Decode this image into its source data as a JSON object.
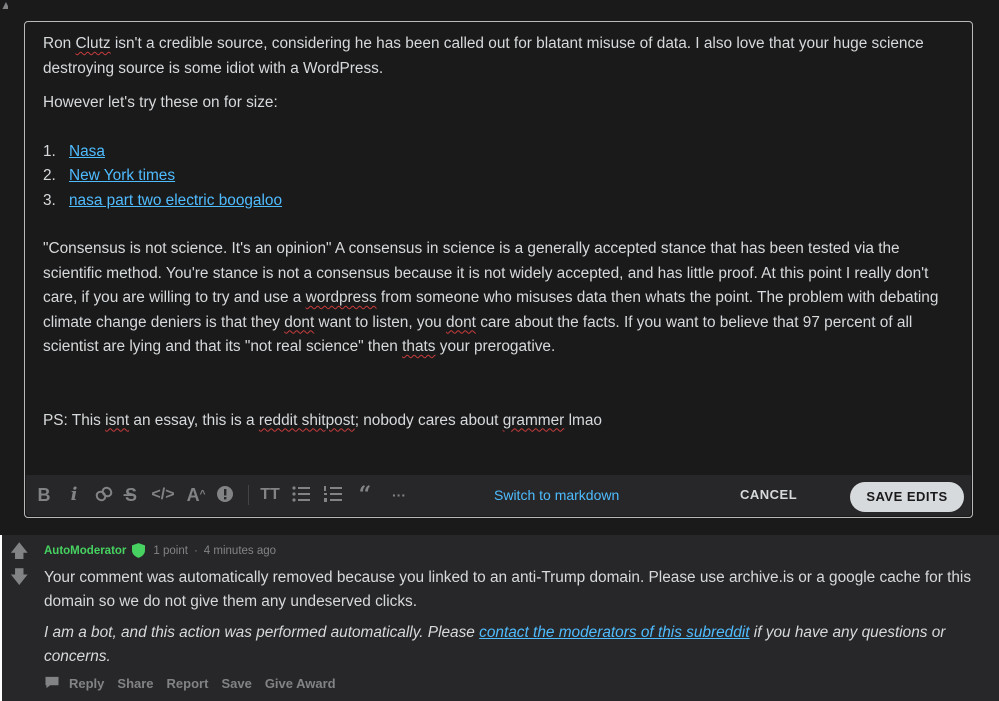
{
  "editor": {
    "paragraph1": {
      "part1": "Ron ",
      "sq1": "Clutz",
      "part2": " isn't a credible source, considering he has been called out for blatant misuse of data. I also love that your huge science destroying source is some idiot with a WordPress."
    },
    "paragraph2": "However let's try these on for size:",
    "links": [
      {
        "num": "1.",
        "label": "Nasa"
      },
      {
        "num": "2.",
        "label": "New York times"
      },
      {
        "num": "3.",
        "label": "nasa part two electric boogaloo"
      }
    ],
    "paragraph3": {
      "a": "\"Consensus is not science. It's an opinion\" A consensus in science is a generally accepted stance that has been tested via the scientific method. You're stance is not a consensus because it is not widely accepted, and has little proof. At this point I really don't care, if you are willing to try and use a ",
      "sq_wordpress": "wordpress",
      "b": " from someone who misuses data then whats the point. The problem with debating climate change deniers is that they ",
      "sq_dont1": "dont",
      "c": " want to listen, you ",
      "sq_dont2": "dont",
      "d": " care about the facts. If you want to believe that 97 percent of all scientist are lying and that its \"not real science\" then ",
      "sq_thats": "thats",
      "e": " your prerogative."
    },
    "paragraph4": {
      "a": "PS: This ",
      "sq_isnt": "isnt",
      "b": " an essay, this is a ",
      "sq_reddit": "reddit shitpost",
      "c": "; nobody cares about ",
      "sq_grammer": "grammer",
      "d": " lmao"
    }
  },
  "toolbar": {
    "icons": [
      "bold-icon",
      "italic-icon",
      "link-icon",
      "strikethrough-icon",
      "inline-code-icon",
      "superscript-icon",
      "spoiler-icon",
      "heading-icon",
      "bulleted-list-icon",
      "numbered-list-icon",
      "quote-block-icon",
      "more-icon"
    ],
    "switch_label": "Switch to markdown",
    "cancel_label": "CANCEL",
    "save_label": "SAVE EDITS"
  },
  "comment": {
    "author": "AutoModerator",
    "points": "1 point",
    "separator": "·",
    "time": "4 minutes ago",
    "body": "Your comment was automatically removed because you linked to an anti-Trump domain. Please use archive.is or a google cache for this domain so we do not give them any undeserved clicks.",
    "bot_note_before": "I am a bot, and this action was performed automatically. Please ",
    "bot_note_link": "contact the moderators of this subreddit",
    "bot_note_after": " if you have any questions or concerns.",
    "actions": {
      "reply": "Reply",
      "share": "Share",
      "report": "Report",
      "save": "Save",
      "give_award": "Give Award"
    }
  },
  "colors": {
    "background": "#1a1a1b",
    "comment_bg": "#272729",
    "text": "#d7dadc",
    "muted": "#818384",
    "link": "#4fbcff",
    "moderator_green": "#46d160"
  }
}
